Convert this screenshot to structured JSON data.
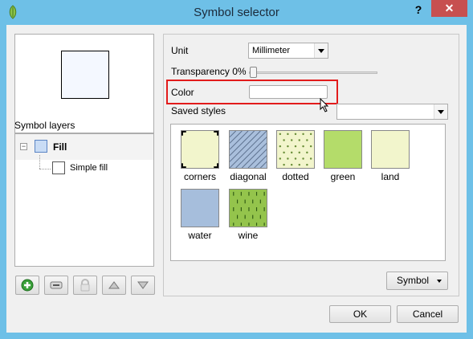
{
  "window": {
    "title": "Symbol selector",
    "help_label": "?",
    "close_label": "✕"
  },
  "left": {
    "symbol_layers_label": "Symbol layers",
    "tree": {
      "parent_label": "Fill",
      "child_label": "Simple fill"
    },
    "toolbar_icons": [
      "add-layer-icon",
      "remove-layer-icon",
      "lock-icon",
      "move-up-icon",
      "move-down-icon"
    ]
  },
  "right": {
    "unit_label": "Unit",
    "unit_value": "Millimeter",
    "transparency_label": "Transparency 0%",
    "transparency_value": 0,
    "color_label": "Color",
    "color_value": "#ffffff",
    "saved_styles_label": "Saved styles",
    "saved_styles_value": "",
    "styles": [
      {
        "name": "corners",
        "color": "#f2f5cc"
      },
      {
        "name": "diagonal",
        "color": "#a9bfdc"
      },
      {
        "name": "dotted",
        "color": "#f2f5cc"
      },
      {
        "name": "green",
        "color": "#b4dc6a"
      },
      {
        "name": "land",
        "color": "#f2f5cc"
      },
      {
        "name": "water",
        "color": "#a6bedc"
      },
      {
        "name": "wine",
        "color": "#94c44c"
      }
    ],
    "symbol_button_label": "Symbol"
  },
  "buttons": {
    "ok_label": "OK",
    "cancel_label": "Cancel"
  },
  "colors": {
    "titlebar": "#6ec0e7",
    "close": "#c75050",
    "highlight": "#e21b1b"
  }
}
